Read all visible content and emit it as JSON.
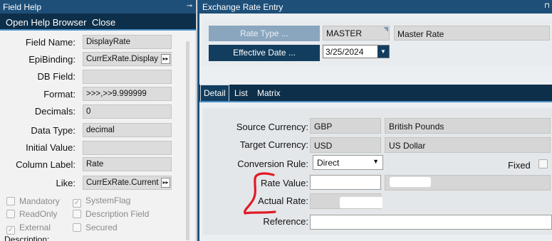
{
  "field_help": {
    "title": "Field Help",
    "pin_glyph": "⊸",
    "menu": {
      "open_help_browser": "Open Help Browser",
      "close": "Close"
    },
    "rows": [
      {
        "label": "Field Name:",
        "value": "DisplayRate",
        "has_button": false
      },
      {
        "label": "EpiBinding:",
        "value": "CurrExRate.Display",
        "has_button": true
      },
      {
        "label": "DB Field:",
        "value": "",
        "has_button": false
      },
      {
        "label": "Format:",
        "value": ">>>,>>9.999999",
        "has_button": false
      },
      {
        "label": "Decimals:",
        "value": "0",
        "has_button": false
      },
      {
        "label": "Data Type:",
        "value": "decimal",
        "has_button": false
      },
      {
        "label": "Initial Value:",
        "value": "",
        "has_button": false
      },
      {
        "label": "Column Label:",
        "value": "Rate",
        "has_button": false
      },
      {
        "label": "Like:",
        "value": "CurrExRate.Current",
        "has_button": true
      }
    ],
    "flags": {
      "mandatory": "Mandatory",
      "systemflag": "SystemFlag",
      "readonly": "ReadOnly",
      "description_field": "Description Field",
      "external": "External",
      "secured": "Secured"
    },
    "description_label": "Description:",
    "button_glyph": "▸▸",
    "check_glyph": "✓"
  },
  "exchange_rate": {
    "title": "Exchange Rate Entry",
    "pin_glyph": "⊓",
    "rate_type_button": "Rate Type ...",
    "rate_type_code": "MASTER",
    "rate_type_desc": "Master Rate",
    "effective_date_button": "Effective Date ...",
    "effective_date": "3/25/2024",
    "tabs": [
      "Detail",
      "List",
      "Matrix"
    ],
    "detail": {
      "source_currency_label": "Source Currency:",
      "source_currency_code": "GBP",
      "source_currency_name": "British Pounds",
      "target_currency_label": "Target Currency:",
      "target_currency_code": "USD",
      "target_currency_name": "US Dollar",
      "conversion_rule_label": "Conversion Rule:",
      "conversion_rule_value": "Direct",
      "fixed_label": "Fixed",
      "rate_value_label": "Rate Value:",
      "actual_rate_label": "Actual Rate:",
      "reference_label": "Reference:"
    }
  },
  "colors": {
    "title_bar": "#1d4f78",
    "menu_bar": "#0e2f49",
    "accent": "#4a90c8",
    "annotation_red": "#e01b24"
  }
}
